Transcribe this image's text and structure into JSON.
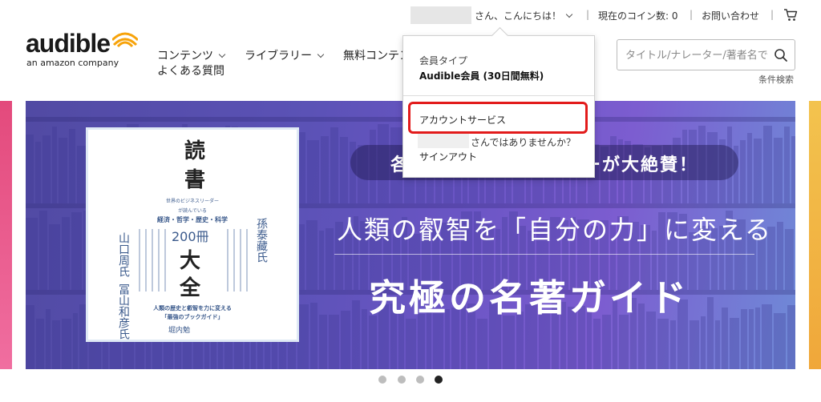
{
  "topbar": {
    "greeting": "さん、こんにちは！",
    "coins": "現在のコイン数: 0",
    "contact": "お問い合わせ",
    "separator": "|"
  },
  "logo": {
    "word": "audible",
    "sub": "an amazon company"
  },
  "nav": {
    "items": [
      {
        "label": "コンテンツ"
      },
      {
        "label": "ライブラリー"
      },
      {
        "label": "無料コンテン"
      }
    ],
    "faq": "よくある質問"
  },
  "search": {
    "placeholder": "タイトル/ナレーター/著者名で",
    "advanced": "条件検索"
  },
  "banner": {
    "pill_text": "各界のビジネスリーダーが大絶賛！",
    "headline": "人類の叡智を「自分の力」に変える",
    "bigline": "究極の名著ガイド",
    "book": {
      "title1": "読",
      "title2": "書",
      "tag": "世界のビジネスリーダー",
      "tag2": "が読んでいる",
      "fields": "経済・哲学・歴史・科学",
      "count": "200冊",
      "big1": "大",
      "big2": "全",
      "author1": "山口周氏",
      "author2": "冨山和彦氏",
      "author3": "孫泰藏氏",
      "blurb1": "人類の歴史と叡智を力に変える",
      "blurb2": "「最強のブックガイド」",
      "editor": "堀内勉"
    }
  },
  "carousel": {
    "total": 4,
    "active": 3
  },
  "dropdown": {
    "type_label": "会員タイプ",
    "type_value": "Audible会員 (30日間無料)",
    "account": "アカウントサービス",
    "not_you": "さんではありませんか？",
    "signout": "サインアウト"
  },
  "colors": {
    "highlight": "#e21b1b",
    "banner_start": "#514aa3",
    "banner_end": "#6f8ad7",
    "logo_orange": "#f7a30a"
  }
}
